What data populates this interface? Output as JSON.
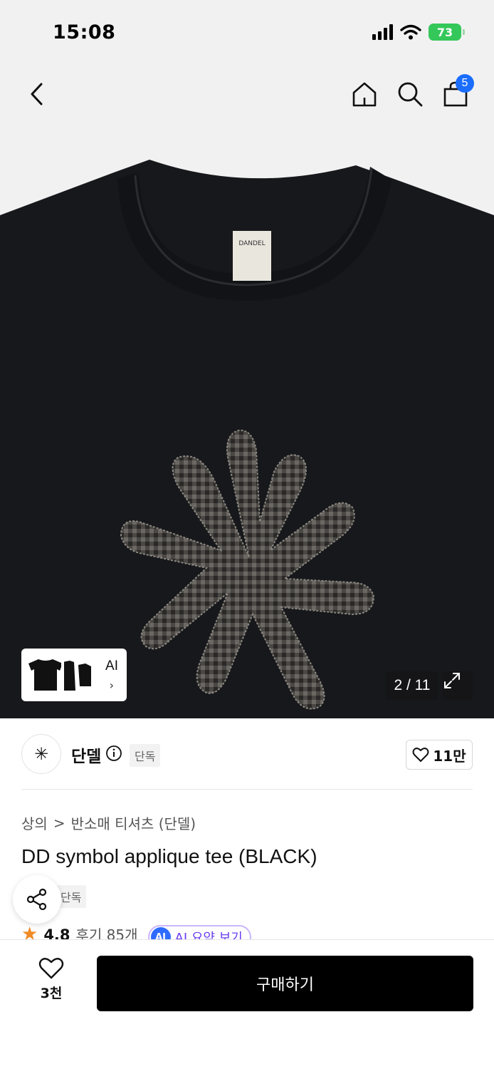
{
  "status_bar": {
    "time": "15:08",
    "battery": "73"
  },
  "nav": {
    "cart_count": "5"
  },
  "gallery": {
    "counter": "2 / 11",
    "ai_label": "AI",
    "ai_chevron": "›"
  },
  "brand": {
    "logo_glyph": "✳",
    "name": "단델",
    "exclusive_badge": "단독",
    "likes": "11만"
  },
  "product": {
    "breadcrumb": [
      "상의",
      ">",
      "반소매 티셔츠 (단델)"
    ],
    "title": "DD symbol applique tee (BLACK)",
    "exclusive_badge": "단독",
    "rating": "4.8",
    "reviews": "후기 85개",
    "ai_badge": "AI",
    "ai_summary": "AI 요약 보기"
  },
  "bottom_bar": {
    "wish_count": "3천",
    "buy_label": "구매하기"
  },
  "icons": [
    "back-icon",
    "home-icon",
    "search-icon",
    "cart-icon",
    "expand-icon",
    "info-icon",
    "heart-icon",
    "share-icon",
    "star-icon",
    "signal-icon",
    "wifi-icon",
    "battery-icon"
  ],
  "colors": {
    "accent_blue": "#1a6dff",
    "battery_green": "#34c759",
    "rating_orange": "#f08a24",
    "ai_purple": "#6a3df0",
    "buy_button": "#000000"
  }
}
